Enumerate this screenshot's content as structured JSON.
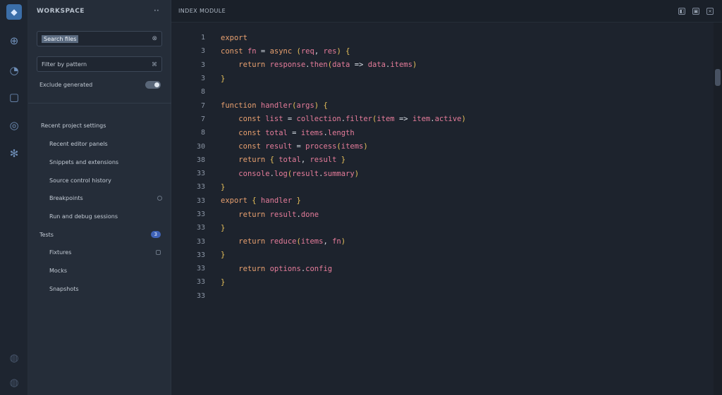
{
  "sidebar": {
    "header_title": "WORKSPACE",
    "header_more": "··",
    "search_value": "Search files",
    "filter_value": "Filter by pattern",
    "filter_hint": "⌘",
    "toggle_label": "Exclude generated",
    "section_label": "Recent project settings",
    "items": [
      {
        "label": "Recent editor panels"
      },
      {
        "label": "Snippets and extensions"
      },
      {
        "label": "Source control history"
      },
      {
        "label": "Breakpoints"
      },
      {
        "label": "Run and debug sessions"
      }
    ],
    "group_label": "Tests",
    "group_badge": "3",
    "group_items": [
      {
        "label": "Fixtures"
      },
      {
        "label": "Mocks"
      },
      {
        "label": "Snapshots"
      }
    ]
  },
  "editor": {
    "tab_title": "INDEX MODULE",
    "lines": [
      {
        "n": "1",
        "t": "export"
      },
      {
        "n": "3",
        "t": "const fn = async (req, res) {"
      },
      {
        "n": "3",
        "t": "    return response.then(data => data.items)"
      },
      {
        "n": "3",
        "t": "}"
      },
      {
        "n": "8",
        "t": ""
      },
      {
        "n": "7",
        "t": "function handler(args) {"
      },
      {
        "n": "7",
        "t": "    const list = collection.filter(item => item.active)"
      },
      {
        "n": "8",
        "t": "    const total = items.length"
      },
      {
        "n": "30",
        "t": "    const result = process(items)"
      },
      {
        "n": "38",
        "t": "    return { total, result }"
      },
      {
        "n": "33",
        "t": "    console.log(result.summary)"
      },
      {
        "n": "33",
        "t": "}"
      },
      {
        "n": "33",
        "t": "export { handler }"
      },
      {
        "n": "33",
        "t": "    return result.done"
      },
      {
        "n": "33",
        "t": "}"
      },
      {
        "n": "33",
        "t": "    return reduce(items, fn)"
      },
      {
        "n": "33",
        "t": "}"
      },
      {
        "n": "33",
        "t": "    return options.config"
      },
      {
        "n": "33",
        "t": "}"
      },
      {
        "n": "33",
        "t": ""
      }
    ]
  }
}
